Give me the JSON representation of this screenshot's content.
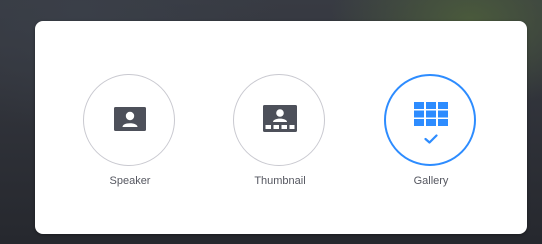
{
  "layout_options": [
    {
      "id": "speaker",
      "label": "Speaker",
      "icon": "speaker-view-icon",
      "selected": false
    },
    {
      "id": "thumbnail",
      "label": "Thumbnail",
      "icon": "thumbnail-view-icon",
      "selected": false
    },
    {
      "id": "gallery",
      "label": "Gallery",
      "icon": "gallery-view-icon",
      "selected": true
    }
  ],
  "colors": {
    "accent": "#2d8cff",
    "icon_gray": "#4d505a",
    "label": "#555760",
    "circle_border": "#c9c9d0"
  },
  "selected_indicator_icon": "checkmark-icon"
}
